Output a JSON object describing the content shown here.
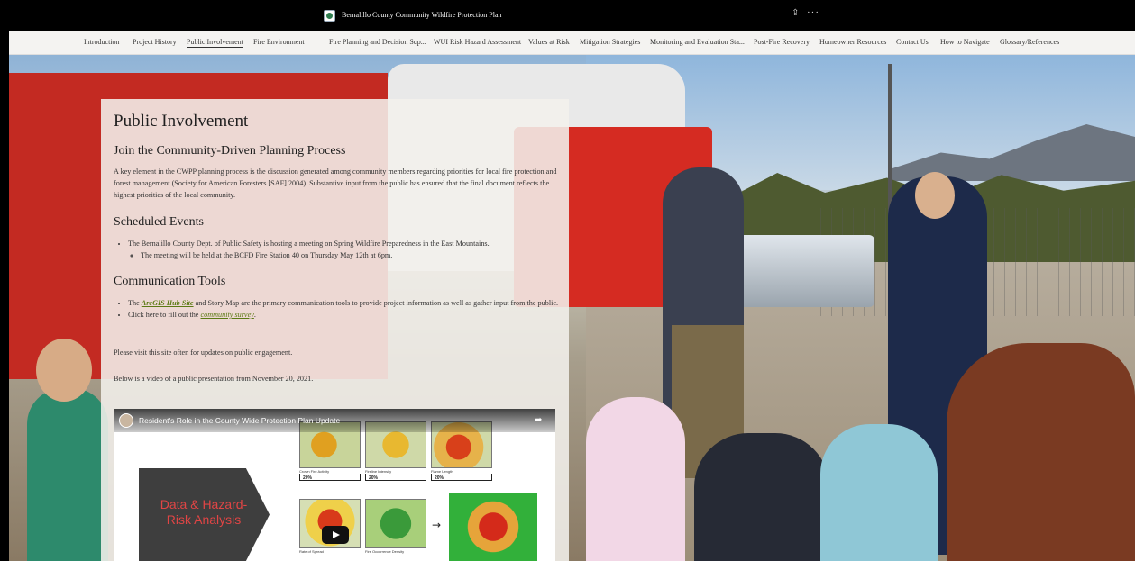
{
  "topbar": {
    "title": "Bernalillo County Community Wildfire Protection Plan",
    "share_glyph": "⇪",
    "more_glyph": "···"
  },
  "nav": {
    "items": [
      {
        "label": "Introduction"
      },
      {
        "label": "Project History"
      },
      {
        "label": "Public Involvement",
        "active": true
      },
      {
        "label": "Fire Environment"
      },
      {
        "label": "Fire Planning and Decision Sup..."
      },
      {
        "label": "WUI Risk Hazard Assessment"
      },
      {
        "label": "Values at Risk"
      },
      {
        "label": "Mitigation Strategies"
      },
      {
        "label": "Monitoring and Evaluation Sta..."
      },
      {
        "label": "Post-Fire Recovery"
      },
      {
        "label": "Homeowner Resources"
      },
      {
        "label": "Contact Us"
      },
      {
        "label": "How to Navigate"
      },
      {
        "label": "Glossary/References"
      }
    ]
  },
  "content": {
    "title": "Public Involvement",
    "section1": {
      "heading": "Join the Community-Driven Planning Process",
      "body": "A key element in the CWPP planning process is the discussion generated among community members regarding priorities for local fire protection and forest management (Society for American Foresters [SAF] 2004). Substantive input from the public has ensured that the final document reflects the highest priorities of the local community."
    },
    "section2": {
      "heading": "Scheduled Events",
      "bullet1": "The Bernalillo County Dept. of Public Safety is hosting a meeting on Spring Wildfire Preparedness in the East Mountains.",
      "sub_bullet1": "The meeting will be held at the BCFD Fire Station 40 on Thursday May 12th at 6pm."
    },
    "section3": {
      "heading": "Communication Tools",
      "bullet1_prefix": "The ",
      "bullet1_link": "ArcGIS Hub Site",
      "bullet1_suffix": " and Story Map are the primary communication tools to provide project information as well as gather input from the public.",
      "bullet2_prefix": "Click here to fill out the ",
      "bullet2_link": "community survey",
      "bullet2_suffix": "."
    },
    "note1": "Please visit this site often for updates on public engagement.",
    "note2": "Below is a video of a public presentation from November 20, 2021."
  },
  "video": {
    "title": "Resident's Role in the County Wide Protection Plan Update",
    "share_glyph": "➦",
    "slide_text": "Data & Hazard-Risk Analysis",
    "map_labels": [
      "Crown Fire Activity",
      "Fireline Intensity",
      "Flame Length",
      "Rate of Spread",
      "Fire Occurrence Density"
    ],
    "percents": [
      "20%",
      "20%",
      "20%"
    ],
    "arrow": "→"
  }
}
